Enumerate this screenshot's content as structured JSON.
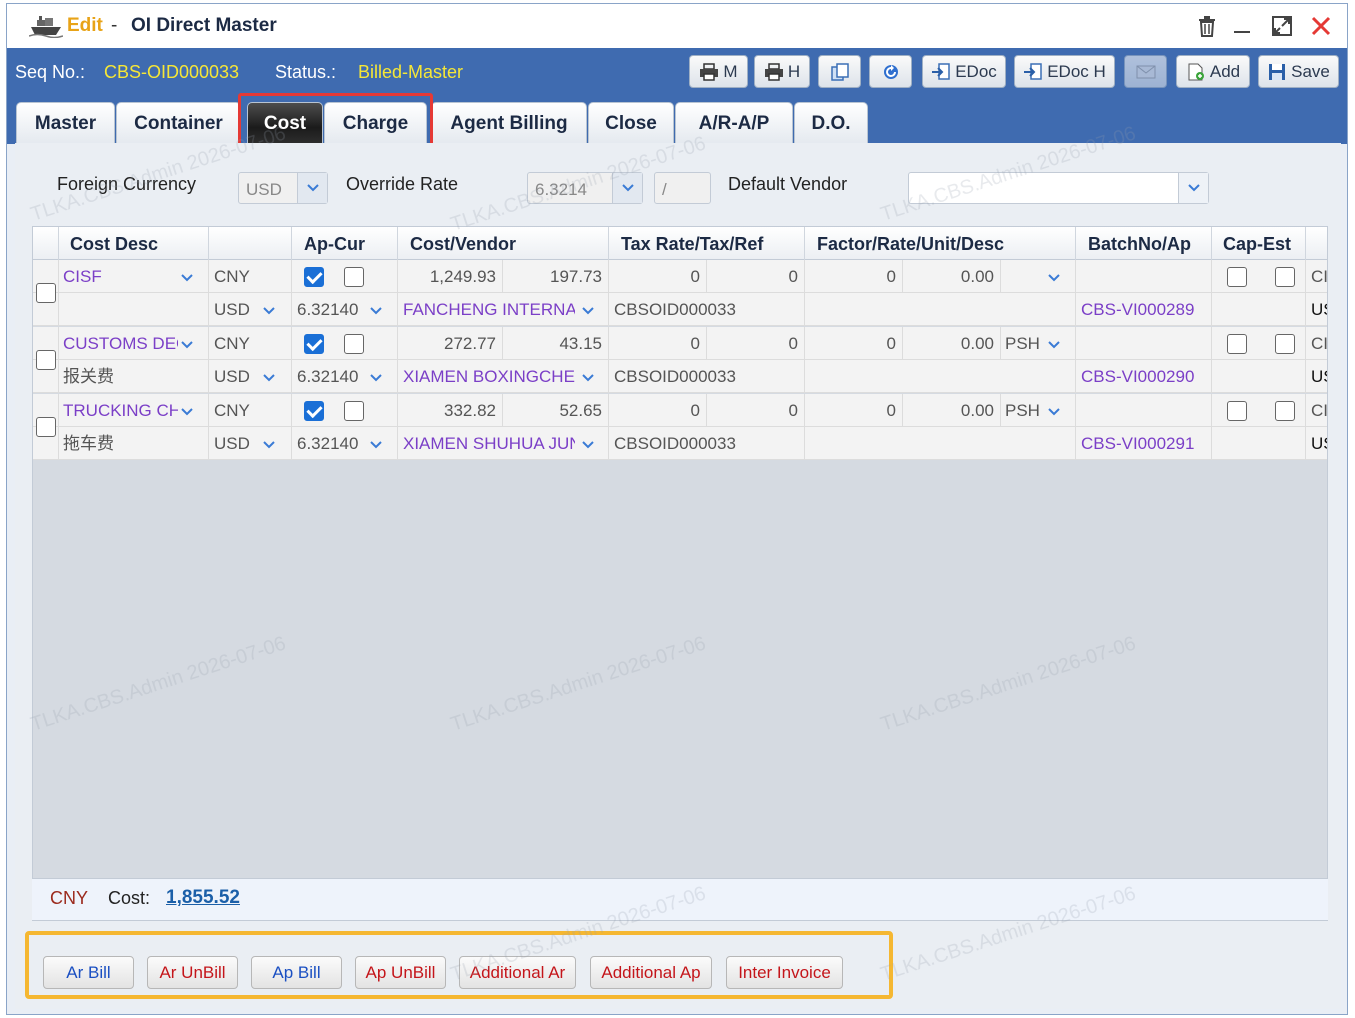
{
  "window": {
    "mode": "Edit",
    "separator": "-",
    "title": "OI Direct Master"
  },
  "seqbar": {
    "seq_label": "Seq No.:",
    "seq_value": "CBS-OID000033",
    "status_label": "Status.:",
    "status_value": "Billed-Master",
    "buttons": {
      "print_m": "M",
      "print_h": "H",
      "edoc": "EDoc",
      "edoc_h": "EDoc H",
      "add": "Add",
      "save": "Save"
    }
  },
  "tabs": [
    "Master",
    "Container",
    "Cost",
    "Charge",
    "Agent Billing",
    "Close",
    "A/R-A/P",
    "D.O."
  ],
  "active_tab": "Cost",
  "filters": {
    "foreign_currency_label": "Foreign Currency",
    "foreign_currency_value": "USD",
    "override_rate_label": "Override Rate",
    "override_rate_value": "6.3214",
    "override_rate_extra": "/",
    "default_vendor_label": "Default Vendor",
    "default_vendor_value": ""
  },
  "grid": {
    "headers": {
      "cost_desc": "Cost Desc",
      "ap_cur": "Ap-Cur",
      "cost_vendor": "Cost/Vendor",
      "tax": "Tax Rate/Tax/Ref",
      "factor": "Factor/Rate/Unit/Desc",
      "batch": "BatchNo/Ap",
      "cap_est": "Cap-Est"
    },
    "rows": [
      {
        "desc": "CISF",
        "desc_cn": "",
        "cur1": "CNY",
        "cur2": "USD",
        "rate": "6.32140",
        "ap_checked": true,
        "amount1": "1,249.93",
        "amount2": "197.73",
        "vendor": "FANCHENG INTERNATIONAL",
        "tax_rate": "0",
        "tax": "0",
        "ref": "CBSOID000033",
        "factor": "0",
        "rate_val": "0.00",
        "unit": "",
        "batch": "CBS-VI000289",
        "cap_extra1": "CI",
        "cap_extra2": "US"
      },
      {
        "desc": "CUSTOMS DEC",
        "desc_cn": "报关费",
        "cur1": "CNY",
        "cur2": "USD",
        "rate": "6.32140",
        "ap_checked": true,
        "amount1": "272.77",
        "amount2": "43.15",
        "vendor": "XIAMEN BOXINGCHENG",
        "tax_rate": "0",
        "tax": "0",
        "ref": "CBSOID000033",
        "factor": "0",
        "rate_val": "0.00",
        "unit": "PSH",
        "batch": "CBS-VI000290",
        "cap_extra1": "CI",
        "cap_extra2": "US"
      },
      {
        "desc": "TRUCKING CH",
        "desc_cn": "拖车费",
        "cur1": "CNY",
        "cur2": "USD",
        "rate": "6.32140",
        "ap_checked": true,
        "amount1": "332.82",
        "amount2": "52.65",
        "vendor": "XIAMEN SHUHUA JUN",
        "tax_rate": "0",
        "tax": "0",
        "ref": "CBSOID000033",
        "factor": "0",
        "rate_val": "0.00",
        "unit": "PSH",
        "batch": "CBS-VI000291",
        "cap_extra1": "CI",
        "cap_extra2": "US"
      }
    ]
  },
  "footer": {
    "currency": "CNY",
    "cost_label": "Cost:",
    "cost_value": "1,855.52"
  },
  "bottom_buttons": {
    "ar_bill": "Ar Bill",
    "ar_unbill": "Ar UnBill",
    "ap_bill": "Ap Bill",
    "ap_unbill": "Ap UnBill",
    "additional_ar": "Additional Ar",
    "additional_ap": "Additional Ap",
    "inter_invoice": "Inter Invoice"
  },
  "watermark": "TLKA.CBS.Admin 2026-07-06"
}
